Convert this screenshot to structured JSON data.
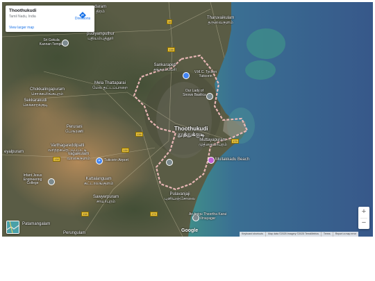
{
  "place_card": {
    "title": "Thoothukudi",
    "subtitle": "Tamil Nadu, India",
    "view_larger_map": "View larger map",
    "directions_label": "Directions"
  },
  "map": {
    "type": "satellite",
    "city_label_en": "Thoothukudi",
    "city_label_ta": "தூத்துக்குடி",
    "places": [
      {
        "text": "daram",
        "ta": "திரம்"
      },
      {
        "text": "Tharuvaikulam",
        "ta": "தருவைகுளம்"
      },
      {
        "text": "Sri Gokula Kannan Temple"
      },
      {
        "text": "pudiyamputhur",
        "ta": "புதியம்புத்தூர்"
      },
      {
        "text": "Sankarapeti",
        "ta": "சங்கரப்பேரி"
      },
      {
        "text": "V.M.C. Tycoon Tuticorin"
      },
      {
        "text": "Mela Thattaparai",
        "ta": "மேல தட்டப்பாறை"
      },
      {
        "text": "Chokkalingapuram",
        "ta": "சொக்கலிங்கபுரம்"
      },
      {
        "text": "Sekkarakudi",
        "ta": "செக்காரக்குடி"
      },
      {
        "text": "Our Lady of Snows Basilica"
      },
      {
        "text": "Perurani",
        "ta": "பேரூரணி"
      },
      {
        "text": "Varthagareddipatti",
        "ta": "வர்த்தகரெட்டிப்பட்டி"
      },
      {
        "text": "Vagaikulam",
        "ta": "வாகைகுளம்"
      },
      {
        "text": "eyalpuram"
      },
      {
        "text": "Tuticorin Airport"
      },
      {
        "text": "Muttayapuram",
        "ta": "முத்தையாபுரம்"
      },
      {
        "text": "Mullakkadu Beach"
      },
      {
        "text": "Infant Jesus Engineering College"
      },
      {
        "text": "Kattalanguam",
        "ta": "கட்டாலங்குளம்"
      },
      {
        "text": "Pulavanjaji",
        "ta": "புளியஞ்சோலை"
      },
      {
        "text": "Sawyerpuram",
        "ta": "சாயர்புரம்"
      },
      {
        "text": "Arulmigu Theertha Karai Vinayagar"
      },
      {
        "text": "Patamangalam",
        "ta": "பட்டமங்கலம்"
      },
      {
        "text": "Perungulam"
      }
    ],
    "highway_shields": [
      "38",
      "138",
      "138",
      "138",
      "179",
      "138",
      "138",
      "179"
    ],
    "google_logo": "Google",
    "zoom_in": "+",
    "zoom_out": "−"
  },
  "attribution": {
    "keyboard": "Keyboard shortcuts",
    "data": "Map data ©2025 Imagery ©2025 TerraMetrics",
    "terms": "Terms",
    "report": "Report a map error"
  },
  "colors": {
    "land_dark": "#3f4a35",
    "land_light": "#7a6a4c",
    "arid": "#b28656",
    "sea": "#3b628c",
    "sea_shallow": "#3f8e8a",
    "boundary": "#f0bcbc",
    "link": "#1a73e8"
  }
}
